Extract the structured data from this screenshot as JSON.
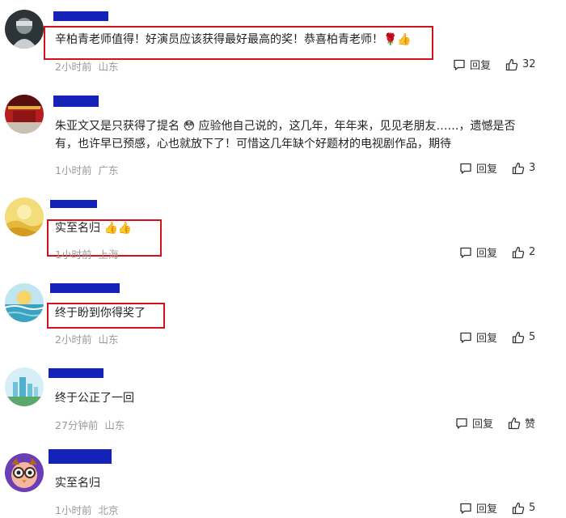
{
  "comments": [
    {
      "text": "辛柏青老师值得！好演员应该获得最好最高的奖！恭喜柏青老师！🌹👍",
      "time": "2小时前",
      "location": "山东",
      "reply_label": "回复",
      "like_count": "32"
    },
    {
      "text_line1": "朱亚文又是只获得了提名 😳 应验他自己说的，这几年，年年来，见见老朋友……，遗憾是否",
      "text_line2": "有，也许早已预感，心也就放下了！可惜这几年缺个好题材的电视剧作品，期待",
      "time": "1小时前",
      "location": "广东",
      "reply_label": "回复",
      "like_count": "3"
    },
    {
      "text": "实至名归 👍👍",
      "time": "1小时前",
      "location": "上海",
      "reply_label": "回复",
      "like_count": "2"
    },
    {
      "text": "终于盼到你得奖了",
      "time": "2小时前",
      "location": "山东",
      "reply_label": "回复",
      "like_count": "5"
    },
    {
      "text": "终于公正了一回",
      "time": "27分钟前",
      "location": "山东",
      "reply_label": "回复",
      "like_count": "赞"
    },
    {
      "text": "实至名归",
      "time": "1小时前",
      "location": "北京",
      "reply_label": "回复",
      "like_count": "5"
    }
  ],
  "colors": {
    "highlight_box": "#d0121b",
    "redaction": "#1422b8",
    "meta_text": "#9a9a9a"
  },
  "icons": {
    "reply": "comment-bubble-icon",
    "like": "thumbs-up-icon"
  }
}
